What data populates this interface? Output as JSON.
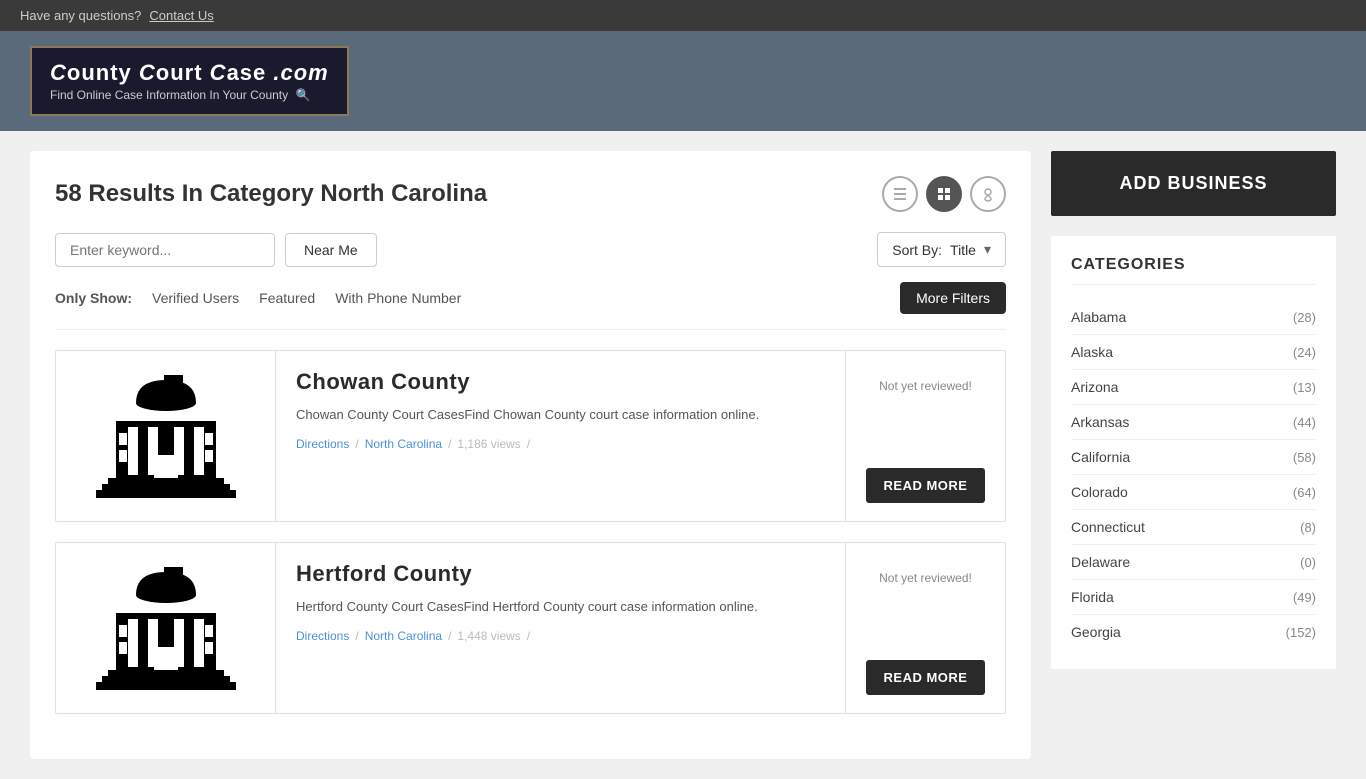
{
  "topbar": {
    "question_text": "Have any questions?",
    "contact_label": "Contact Us"
  },
  "header": {
    "logo_title": "County Court Case .com",
    "logo_subtitle": "Find Online Case Information In Your County",
    "logo_emoji": "🔍"
  },
  "results": {
    "title": "58 Results In Category North Carolina",
    "count": "58"
  },
  "search": {
    "keyword_placeholder": "Enter keyword...",
    "near_me_label": "Near Me",
    "sort_label": "Sort By:",
    "sort_value": "Title",
    "sort_arrow": "▾"
  },
  "filters": {
    "only_show_label": "Only Show:",
    "verified_users": "Verified Users",
    "featured": "Featured",
    "with_phone": "With Phone Number",
    "more_filters": "More Filters"
  },
  "listings": [
    {
      "name": "Chowan County",
      "description": "Chowan County Court CasesFind Chowan County court case information online.",
      "directions": "Directions",
      "location": "North Carolina",
      "views": "1,186 views",
      "review_status": "Not yet reviewed!",
      "read_more": "READ MORE"
    },
    {
      "name": "Hertford County",
      "description": "Hertford County Court CasesFind Hertford County court case information online.",
      "directions": "Directions",
      "location": "North Carolina",
      "views": "1,448 views",
      "review_status": "Not yet reviewed!",
      "read_more": "READ MORE"
    }
  ],
  "sidebar": {
    "add_business_label": "ADD BUSINESS",
    "categories_title": "CATEGORIES",
    "categories": [
      {
        "name": "Alabama",
        "count": "(28)"
      },
      {
        "name": "Alaska",
        "count": "(24)"
      },
      {
        "name": "Arizona",
        "count": "(13)"
      },
      {
        "name": "Arkansas",
        "count": "(44)"
      },
      {
        "name": "California",
        "count": "(58)"
      },
      {
        "name": "Colorado",
        "count": "(64)"
      },
      {
        "name": "Connecticut",
        "count": "(8)"
      },
      {
        "name": "Delaware",
        "count": "(0)"
      },
      {
        "name": "Florida",
        "count": "(49)"
      },
      {
        "name": "Georgia",
        "count": "(152)"
      }
    ]
  }
}
